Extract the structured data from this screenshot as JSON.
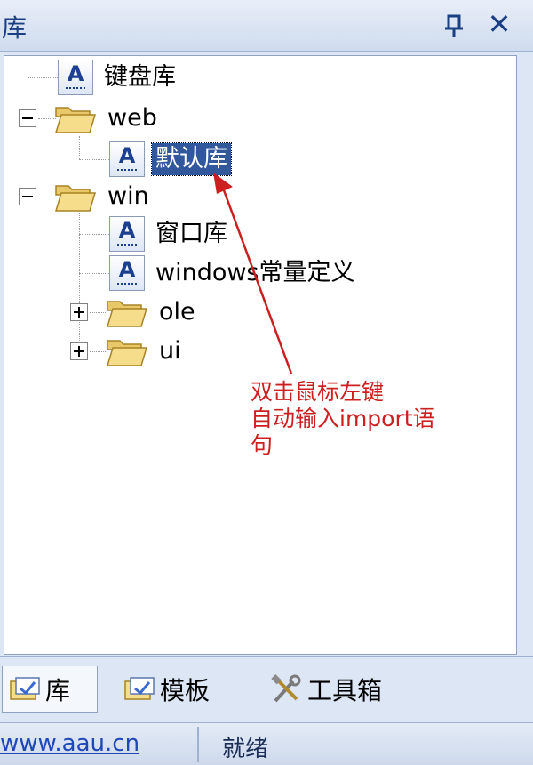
{
  "window": {
    "title": "库"
  },
  "tree": {
    "items": [
      {
        "label": "键盘库"
      },
      {
        "label": "web"
      },
      {
        "label": "默认库"
      },
      {
        "label": "win"
      },
      {
        "label": "窗口库"
      },
      {
        "label": "windows常量定义"
      },
      {
        "label": "ole"
      },
      {
        "label": "ui"
      }
    ]
  },
  "annotation": {
    "lines": [
      "双击鼠标左键",
      "自动输入import语",
      "句"
    ]
  },
  "tabs": [
    {
      "label": "库"
    },
    {
      "label": "模板"
    },
    {
      "label": "工具箱"
    }
  ],
  "status": {
    "url": "www.aau.cn",
    "text": "就绪"
  },
  "colors": {
    "selection": "#31579d",
    "annotation": "#cc1f1f",
    "title_text": "#1b3f83"
  }
}
